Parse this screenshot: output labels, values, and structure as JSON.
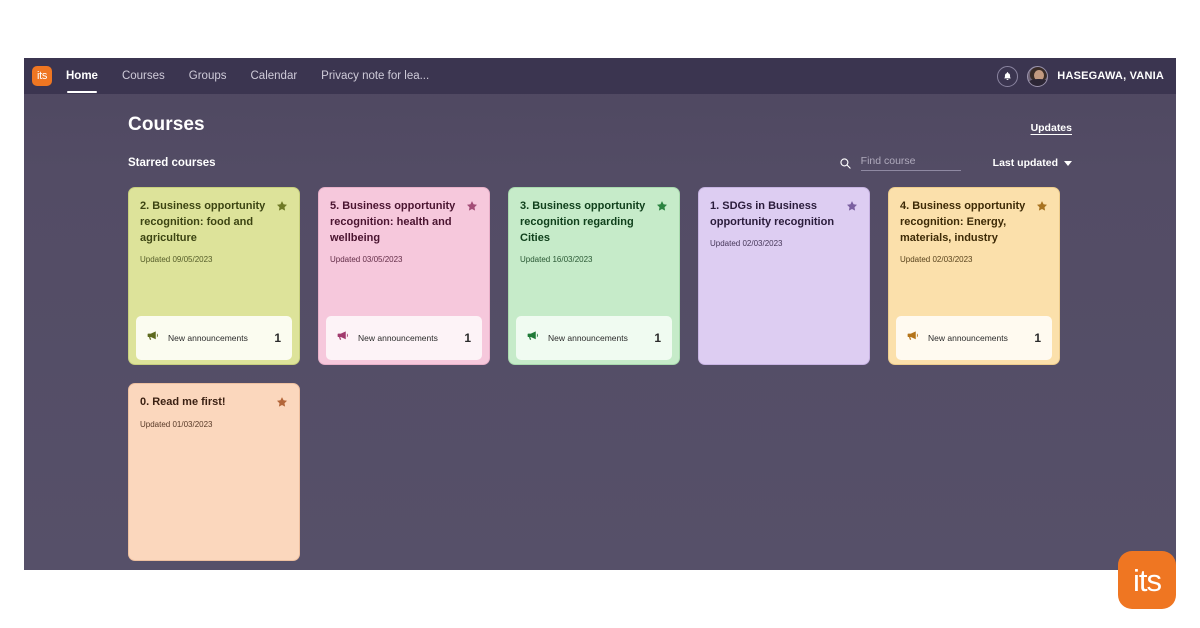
{
  "nav": {
    "logo_text": "its",
    "items": [
      {
        "label": "Home",
        "active": true
      },
      {
        "label": "Courses",
        "active": false
      },
      {
        "label": "Groups",
        "active": false
      },
      {
        "label": "Calendar",
        "active": false
      },
      {
        "label": "Privacy note for lea...",
        "active": false
      }
    ],
    "bell_icon": "bell-icon",
    "user_name": "HASEGAWA, VANIA"
  },
  "header": {
    "page_title": "Courses",
    "updates_link": "Updates"
  },
  "section": {
    "title": "Starred courses"
  },
  "search": {
    "icon": "search-icon",
    "value": "",
    "placeholder": "Find course"
  },
  "sort": {
    "label": "Last updated",
    "caret_icon": "chevron-down-icon"
  },
  "corner_logo": {
    "text": "its",
    "color": "#ef7622"
  },
  "cards": [
    {
      "title": "2. Business opportunity recognition: food and agriculture",
      "updated": "Updated 09/05/2023",
      "starred": true,
      "star_icon": "star-filled-icon",
      "bg": "#dde39a",
      "border": "#c8d07e",
      "title_color": "#3c4412",
      "updated_color": "#4a5220",
      "star_color": "#6f7a26",
      "footer": {
        "icon": "megaphone-icon",
        "icon_color": "#5d6a1e",
        "label": "New announcements",
        "count": "1",
        "bg": "#fbfcf0"
      }
    },
    {
      "title": "5. Business opportunity recognition: health and wellbeing",
      "updated": "Updated 03/05/2023",
      "starred": true,
      "star_icon": "star-filled-icon",
      "bg": "#f6c8dc",
      "border": "#e8b0c9",
      "title_color": "#4a1430",
      "updated_color": "#56203b",
      "star_color": "#a34d77",
      "footer": {
        "icon": "megaphone-icon",
        "icon_color": "#a13a6e",
        "label": "New announcements",
        "count": "1",
        "bg": "#fdf3f7"
      }
    },
    {
      "title": "3. Business opportunity recognition regarding Cities",
      "updated": "Updated 16/03/2023",
      "starred": true,
      "star_icon": "star-filled-icon",
      "bg": "#c6ebc9",
      "border": "#a9daae",
      "title_color": "#10401c",
      "updated_color": "#1c4b27",
      "star_color": "#2b8340",
      "footer": {
        "icon": "megaphone-icon",
        "icon_color": "#1f7a37",
        "label": "New announcements",
        "count": "1",
        "bg": "#f0fbf1"
      }
    },
    {
      "title": "1. SDGs in Business opportunity recognition",
      "updated": "Updated 02/03/2023",
      "starred": true,
      "star_icon": "star-filled-icon",
      "bg": "#ddcdf2",
      "border": "#c7b3e2",
      "title_color": "#2a1c3b",
      "updated_color": "#392a4c",
      "star_color": "#7a5fa0",
      "footer": null
    },
    {
      "title": "4. Business opportunity recognition: Energy, materials, industry",
      "updated": "Updated 02/03/2023",
      "starred": true,
      "star_icon": "star-filled-icon",
      "bg": "#fbe0ab",
      "border": "#eecd8d",
      "title_color": "#3d2a06",
      "updated_color": "#4a3510",
      "star_color": "#a87320",
      "footer": {
        "icon": "megaphone-icon",
        "icon_color": "#b4741a",
        "label": "New announcements",
        "count": "1",
        "bg": "#fffaf0"
      }
    },
    {
      "title": "0. Read me first!",
      "updated": "Updated 01/03/2023",
      "starred": true,
      "star_icon": "star-filled-icon",
      "bg": "#fbd7bd",
      "border": "#eec0a0",
      "title_color": "#3b2113",
      "updated_color": "#4a2c1b",
      "star_color": "#b3663a",
      "footer": null
    }
  ]
}
